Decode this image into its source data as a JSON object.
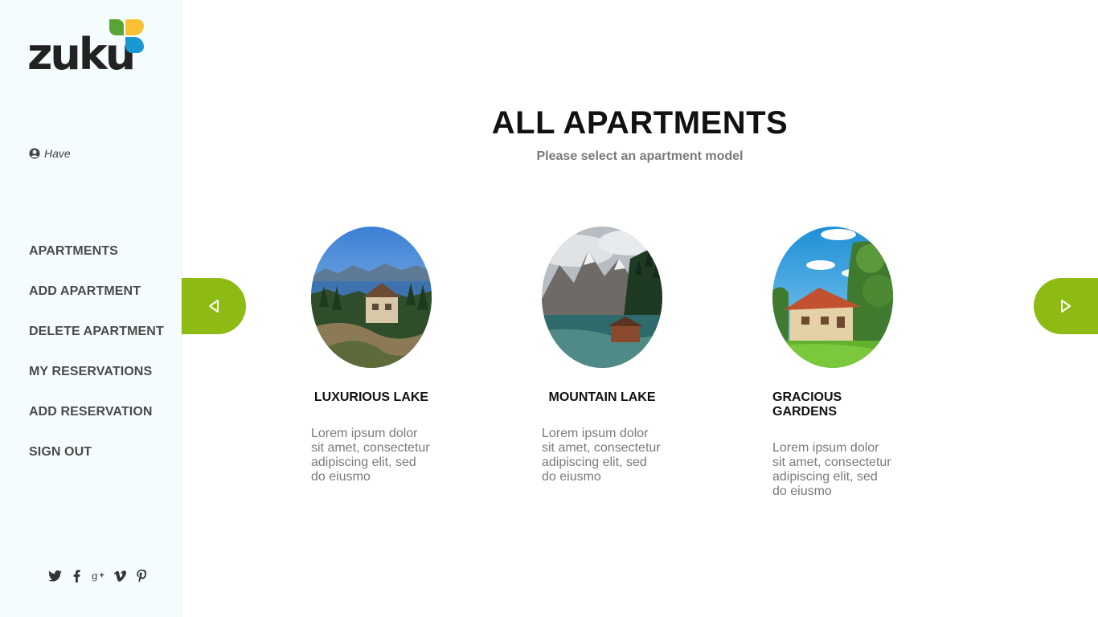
{
  "sidebar": {
    "logo_text": "zuku",
    "user_name": "Have",
    "nav": [
      {
        "label": "APARTMENTS"
      },
      {
        "label": "ADD APARTMENT"
      },
      {
        "label": "DELETE APARTMENT"
      },
      {
        "label": "MY RESERVATIONS"
      },
      {
        "label": "ADD RESERVATION"
      },
      {
        "label": "SIGN OUT"
      }
    ],
    "social": [
      "twitter-icon",
      "facebook-icon",
      "google-plus-icon",
      "vimeo-icon",
      "pinterest-icon"
    ]
  },
  "main": {
    "title": "ALL APARTMENTS",
    "subtitle": "Please select an apartment model",
    "accent_color": "#8dbb14",
    "cards": [
      {
        "title": "LUXURIOUS LAKE",
        "description": "Lorem ipsum dolor sit amet, consectetur adipiscing elit, sed do eiusmo"
      },
      {
        "title": "MOUNTAIN LAKE",
        "description": "Lorem ipsum dolor sit amet, consectetur adipiscing elit, sed do eiusmo"
      },
      {
        "title": "GRACIOUS GARDENS",
        "description": "Lorem ipsum dolor sit amet, consectetur adipiscing elit, sed do eiusmo"
      }
    ]
  }
}
